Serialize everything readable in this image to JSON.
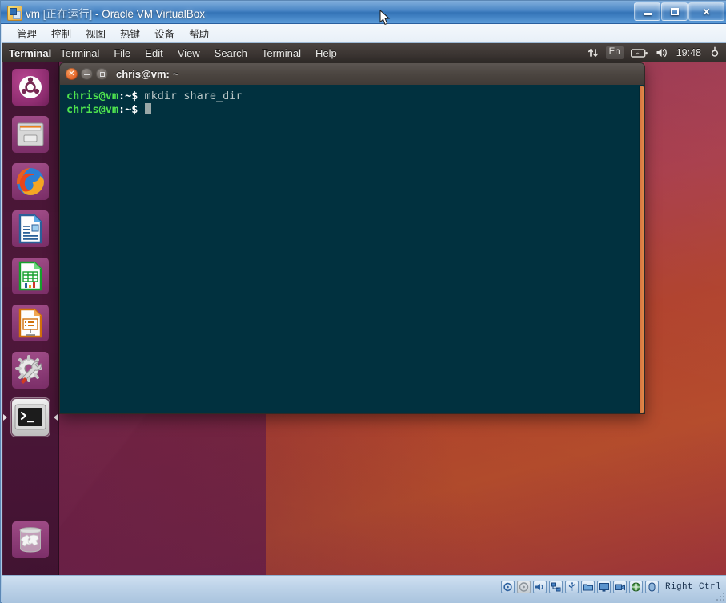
{
  "vbox": {
    "title_prefix": "vm ",
    "title_state": "[正在运行]",
    "title_suffix": " - Oracle VM VirtualBox",
    "window_icon": "virtualbox-icon",
    "controls": {
      "minimize": "minimize-button",
      "maximize": "maximize-button",
      "close": "close-button",
      "close_glyph": "✕"
    },
    "menus": [
      {
        "label": "管理",
        "name": "menu-manage"
      },
      {
        "label": "控制",
        "name": "menu-control"
      },
      {
        "label": "视图",
        "name": "menu-view"
      },
      {
        "label": "热键",
        "name": "menu-hotkey"
      },
      {
        "label": "设备",
        "name": "menu-devices"
      },
      {
        "label": "帮助",
        "name": "menu-help"
      }
    ],
    "statusbar": {
      "icons": [
        "harddisk-icon",
        "optical-disk-icon",
        "audio-icon",
        "network-icon",
        "usb-icon",
        "shared-folder-icon",
        "display-icon",
        "video-capture-icon",
        "remote-desktop-icon",
        "mouse-integration-icon",
        "keyboard-icon"
      ],
      "host_key_label": "Right Ctrl"
    }
  },
  "ubuntu": {
    "panel": {
      "app_name": "Terminal",
      "menus": [
        {
          "label": "Terminal",
          "name": "app-menu-terminal"
        },
        {
          "label": "File",
          "name": "app-menu-file"
        },
        {
          "label": "Edit",
          "name": "app-menu-edit"
        },
        {
          "label": "View",
          "name": "app-menu-view"
        },
        {
          "label": "Search",
          "name": "app-menu-search"
        },
        {
          "label": "Terminal",
          "name": "app-menu-terminal-2"
        },
        {
          "label": "Help",
          "name": "app-menu-help"
        }
      ],
      "indicators": {
        "network": "network-arrows-icon",
        "keyboard_layout": "En",
        "battery": "battery-charging-icon",
        "volume": "volume-icon",
        "clock": "19:48",
        "session": "gear-icon"
      }
    },
    "launcher": {
      "items": [
        {
          "name": "launcher-item-dash",
          "label": "Ubuntu Dash",
          "icon": "ubuntu-logo-icon",
          "active": false
        },
        {
          "name": "launcher-item-files",
          "label": "Files",
          "icon": "file-cabinet-icon",
          "active": false
        },
        {
          "name": "launcher-item-firefox",
          "label": "Firefox Web Browser",
          "icon": "firefox-icon",
          "active": false
        },
        {
          "name": "launcher-item-writer",
          "label": "LibreOffice Writer",
          "icon": "document-writer-icon",
          "active": false
        },
        {
          "name": "launcher-item-calc",
          "label": "LibreOffice Calc",
          "icon": "spreadsheet-calc-icon",
          "active": false
        },
        {
          "name": "launcher-item-impress",
          "label": "LibreOffice Impress",
          "icon": "presentation-icon",
          "active": false
        },
        {
          "name": "launcher-item-settings",
          "label": "System Settings",
          "icon": "gear-wrench-icon",
          "active": false
        },
        {
          "name": "launcher-item-terminal",
          "label": "Terminal",
          "icon": "terminal-icon",
          "active": true
        },
        {
          "name": "launcher-item-trash",
          "label": "Trash",
          "icon": "trash-bin-icon",
          "active": false
        }
      ]
    },
    "terminal": {
      "title": "chris@vm: ~",
      "buttons": {
        "close": "close-icon",
        "minimize": "minimize-icon",
        "maximize": "maximize-icon"
      },
      "lines": [
        {
          "prompt_user": "chris@vm",
          "prompt_path": ":~$",
          "command": " mkdir share_dir",
          "cursor": false
        },
        {
          "prompt_user": "chris@vm",
          "prompt_path": ":~$",
          "command": " ",
          "cursor": true
        }
      ]
    }
  }
}
